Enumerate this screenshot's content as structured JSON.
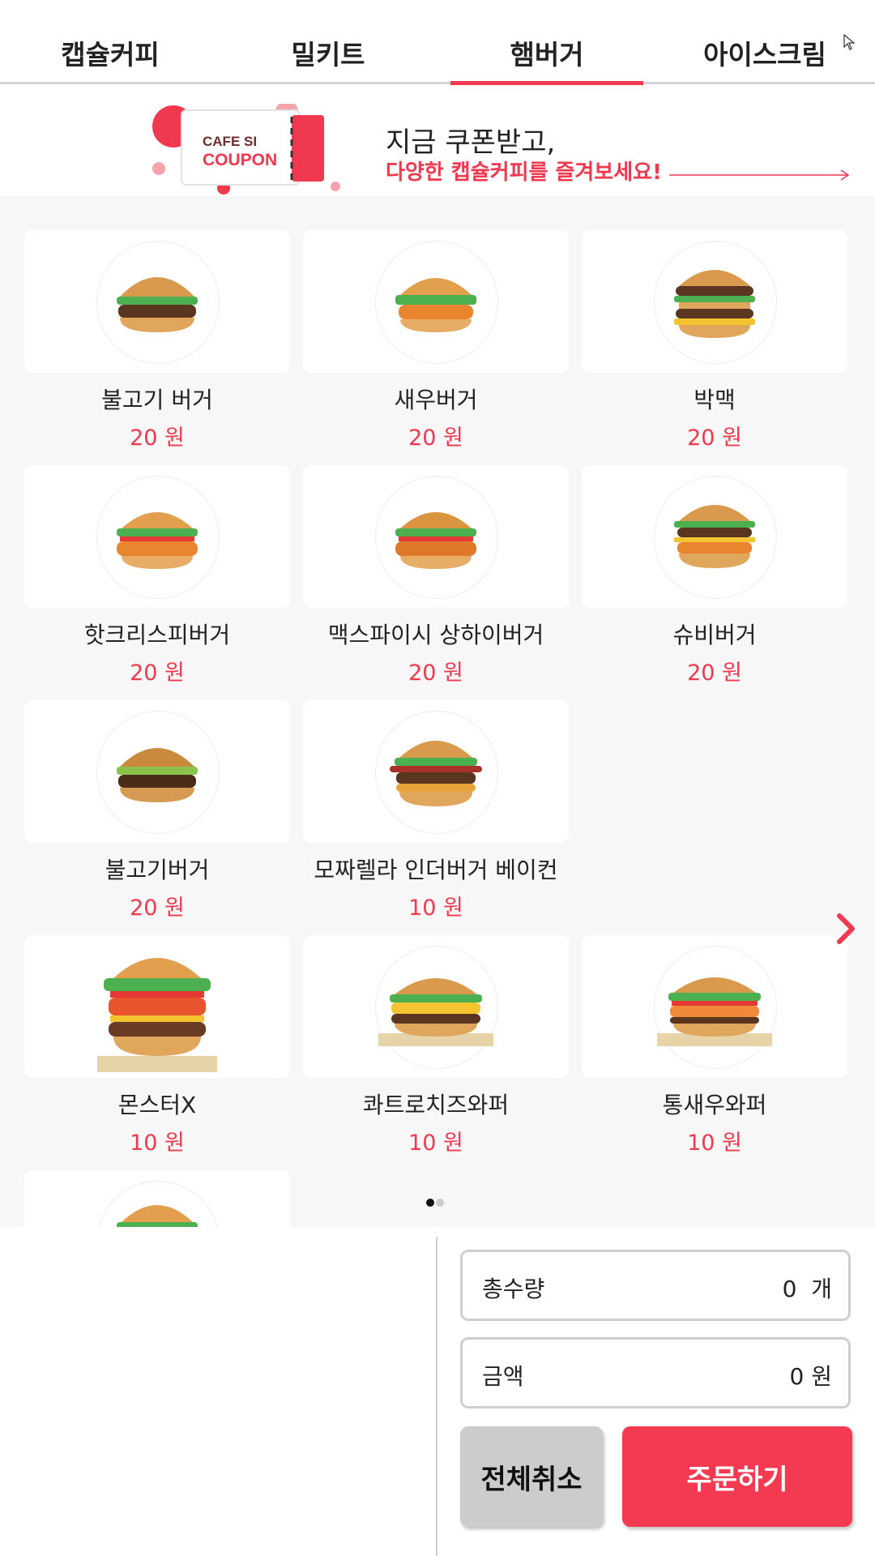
{
  "tabs": [
    {
      "label": "캡슐커피",
      "active": false
    },
    {
      "label": "밀키트",
      "active": false
    },
    {
      "label": "햄버거",
      "active": true
    },
    {
      "label": "아이스크림",
      "active": false
    }
  ],
  "banner": {
    "coupon_brand": "CAFE SI",
    "coupon_word": "COUPON",
    "line1": "지금 쿠폰받고,",
    "line2": "다양한 캡슐커피를 즐겨보세요!"
  },
  "products": [
    {
      "name": "불고기 버거",
      "price": "20 원"
    },
    {
      "name": "새우버거",
      "price": "20 원"
    },
    {
      "name": "박맥",
      "price": "20 원"
    },
    {
      "name": "핫크리스피버거",
      "price": "20 원"
    },
    {
      "name": "맥스파이시 상하이버거",
      "price": "20 원"
    },
    {
      "name": "슈비버거",
      "price": "20 원"
    },
    {
      "name": "불고기버거",
      "price": "20 원"
    },
    {
      "name": "모짜렐라 인더버거 베이컨",
      "price": "10 원"
    },
    {
      "name": "몬스터X",
      "price": "10 원"
    },
    {
      "name": "콰트로치즈와퍼",
      "price": "10 원"
    },
    {
      "name": "통새우와퍼",
      "price": "10 원"
    }
  ],
  "summary": {
    "qty_label": "총수량",
    "qty_value": "0",
    "qty_unit": "개",
    "amount_label": "금액",
    "amount_value": "0",
    "amount_unit": "원"
  },
  "buttons": {
    "cancel_all": "전체취소",
    "order": "주문하기"
  },
  "pagination": {
    "current": 1,
    "total": 2
  },
  "colors": {
    "accent": "#f0384e",
    "page_bg": "#f7f7f7",
    "cancel_bg": "#cccccc"
  }
}
